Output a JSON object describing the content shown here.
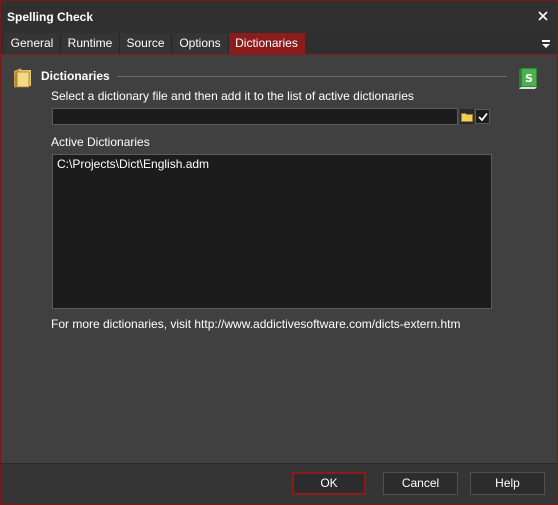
{
  "window": {
    "title": "Spelling Check"
  },
  "tabs": [
    {
      "label": "General"
    },
    {
      "label": "Runtime"
    },
    {
      "label": "Source"
    },
    {
      "label": "Options"
    },
    {
      "label": "Dictionaries",
      "active": true
    }
  ],
  "section": {
    "title": "Dictionaries"
  },
  "dictionary_file": {
    "label": "Select a dictionary file and then add it to the list of active dictionaries",
    "value": ""
  },
  "active_dictionaries": {
    "label": "Active Dictionaries",
    "items": [
      "C:\\Projects\\Dict\\English.adm"
    ]
  },
  "more_info": "For more dictionaries, visit http://www.addictivesoftware.com/dicts-extern.htm",
  "buttons": {
    "ok": "OK",
    "cancel": "Cancel",
    "help": "Help"
  },
  "colors": {
    "accent": "#8a1c1c",
    "background": "#404040",
    "input_background": "#1c1c1c",
    "text": "#ffffff"
  },
  "icons": {
    "section": "book-folder-icon",
    "script": "green-script-book-icon",
    "close": "close-icon",
    "tab_menu": "menu-chevron-icon",
    "browse": "folder-icon",
    "add": "checkmark-icon"
  }
}
